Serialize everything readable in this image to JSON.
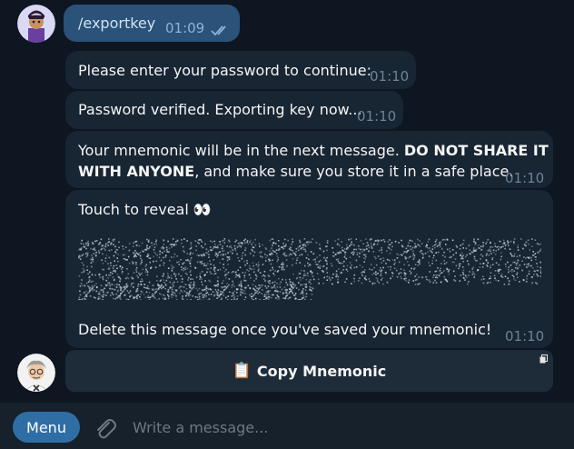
{
  "messages": {
    "user_command": {
      "text": "/exportkey",
      "time": "01:09",
      "status_icon": "double-check-icon"
    },
    "bot_password_prompt": {
      "text": "Please enter your password to continue:",
      "time": "01:10"
    },
    "bot_verified": {
      "text": "Password verified. Exporting key now...",
      "time": "01:10"
    },
    "bot_warning": {
      "line1_prefix": "Your mnemonic will be in the next message. ",
      "line1_bold": "DO NOT SHARE IT",
      "line2_bold": "WITH ANYONE",
      "line2_suffix": ", and make sure you store it in a safe place.",
      "time": "01:10"
    },
    "bot_mnemonic": {
      "reveal_text": "Touch to reveal 👀",
      "delete_text": "Delete this message once you've saved your mnemonic!",
      "time": "01:10"
    }
  },
  "keyboard": {
    "copy_button_icon": "📋",
    "copy_button_label": "Copy Mnemonic"
  },
  "composer": {
    "menu_label": "Menu",
    "placeholder": "Write a message..."
  },
  "colors": {
    "background": "#0e1621",
    "incoming_bubble": "#182533",
    "outgoing_bubble": "#2b5278",
    "accent": "#2f6ea5"
  }
}
